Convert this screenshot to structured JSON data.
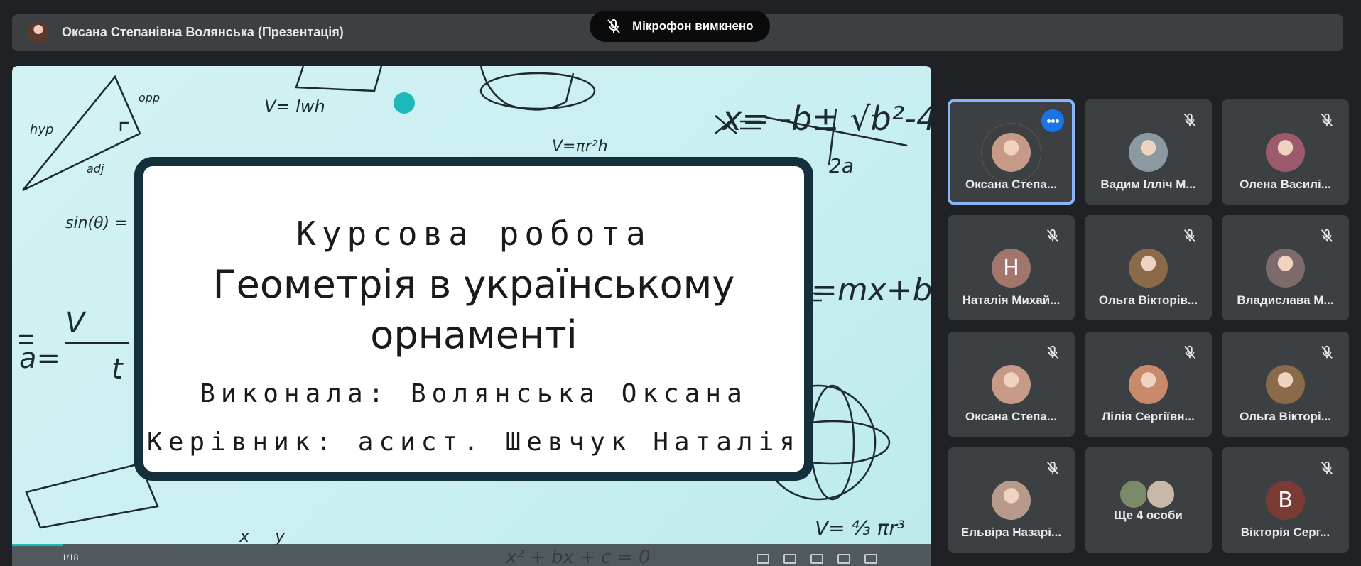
{
  "header": {
    "presenter_name": "Оксана Степанівна Волянська (Презентація)",
    "mic_status": "Мікрофон вимкнено"
  },
  "slide": {
    "line1": "Курсова робота",
    "line2": "Геометрія в українському",
    "line3": "орнаменті",
    "line4": "Виконала: Волянська Оксана",
    "line5": "Керівник: асист. Шевчук Наталія",
    "page": "1/18",
    "progress": 0.055
  },
  "participants": [
    {
      "name": "Оксана Степа...",
      "type": "photo",
      "color": "#c69a86",
      "active": true,
      "muted": false
    },
    {
      "name": "Вадим Ілліч М...",
      "type": "photo",
      "color": "#8a9aa0",
      "active": false,
      "muted": true
    },
    {
      "name": "Олена Василі...",
      "type": "photo",
      "color": "#9c5a6c",
      "active": false,
      "muted": true
    },
    {
      "name": "Наталія Михай...",
      "type": "initial",
      "initial": "Н",
      "color": "#a1776d",
      "active": false,
      "muted": true
    },
    {
      "name": "Ольга Вікторів...",
      "type": "photo",
      "color": "#8a6a48",
      "active": false,
      "muted": true
    },
    {
      "name": "Владислава М...",
      "type": "photo",
      "color": "#7d6a6a",
      "active": false,
      "muted": true
    },
    {
      "name": "Оксана Степа...",
      "type": "photo",
      "color": "#c69a86",
      "active": false,
      "muted": true
    },
    {
      "name": "Лілія Сергіївн...",
      "type": "photo",
      "color": "#c88a6a",
      "active": false,
      "muted": true
    },
    {
      "name": "Ольга Вікторі...",
      "type": "photo",
      "color": "#8a6a48",
      "active": false,
      "muted": true
    },
    {
      "name": "Ельвіра Назарі...",
      "type": "photo",
      "color": "#b89a8a",
      "active": false,
      "muted": true
    },
    {
      "name": "Ще 4 особи",
      "type": "group",
      "color": "#7a8a6a",
      "active": false,
      "muted": false
    },
    {
      "name": "Вікторія Серг...",
      "type": "initial",
      "initial": "В",
      "color": "#7b3b35",
      "active": false,
      "muted": true
    }
  ]
}
